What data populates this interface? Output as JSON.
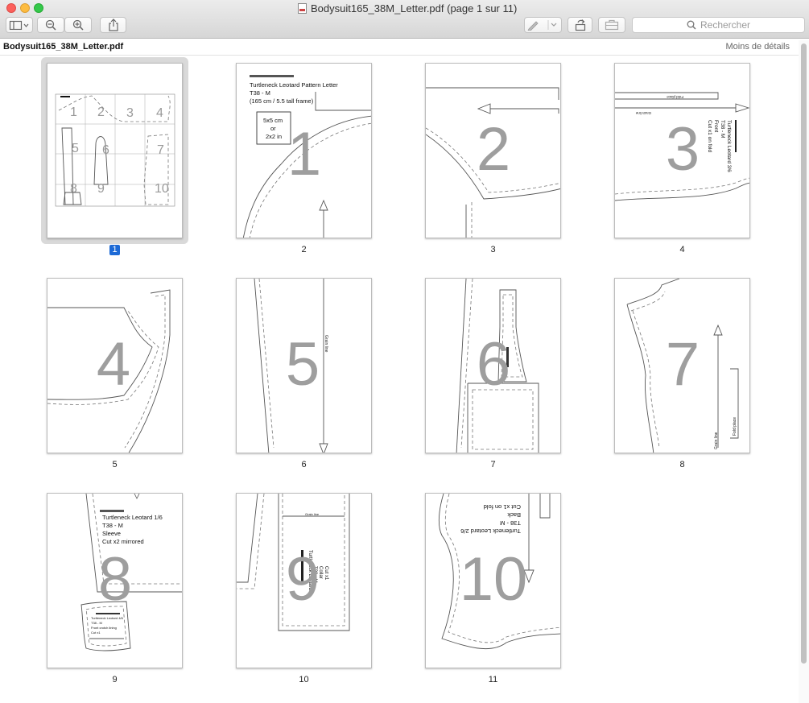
{
  "window": {
    "title": "Bodysuit165_38M_Letter.pdf (page 1 sur 11)",
    "filename": "Bodysuit165_38M_Letter.pdf",
    "details_button": "Moins de détails",
    "search_placeholder": "Rechercher"
  },
  "toolbar": {
    "sidebar_icon": "sidebar-icon",
    "zoom_out_icon": "zoom-out-icon",
    "zoom_in_icon": "zoom-in-icon",
    "share_icon": "share-icon",
    "markup_icon": "pen-icon",
    "rotate_icon": "rotate-icon",
    "toolbox_icon": "toolbox-icon"
  },
  "selected_page": 1,
  "pages": [
    {
      "label": "1",
      "big": ""
    },
    {
      "label": "2",
      "big": "1",
      "texts": [
        "Turtleneck Leotard Pattern Letter",
        "T38 - M",
        "(165 cm / 5.5 tall frame)",
        "5x5 cm",
        "or",
        "2x2 in"
      ]
    },
    {
      "label": "3",
      "big": "2"
    },
    {
      "label": "4",
      "big": "3",
      "texts": [
        "Turtleneck Leotard 3/6",
        "T38 - M",
        "Front",
        "Cut x1 on fold",
        "Fold place",
        "Grain line"
      ]
    },
    {
      "label": "5",
      "big": "4"
    },
    {
      "label": "6",
      "big": "5",
      "texts": [
        "Grain line"
      ]
    },
    {
      "label": "7",
      "big": "6"
    },
    {
      "label": "8",
      "big": "7",
      "texts": [
        "Grain line",
        "Fold place"
      ]
    },
    {
      "label": "9",
      "big": "8",
      "texts": [
        "Turtleneck Leotard 1/6",
        "T38 - M",
        "Sleeve",
        "Cut x2 mirrored",
        "Turtleneck Leotard 4/6",
        "T38 - M",
        "Front crotch lining",
        "Cut x1"
      ]
    },
    {
      "label": "10",
      "big": "9",
      "texts": [
        "Turtleneck Leotard",
        "T38 - M",
        "Collar",
        "Cut x1",
        "Grain line"
      ]
    },
    {
      "label": "11",
      "big": "10",
      "texts": [
        "Turtleneck Leotard 2/6",
        "T38 - M",
        "Back",
        "Cut x1 on fold"
      ]
    }
  ]
}
